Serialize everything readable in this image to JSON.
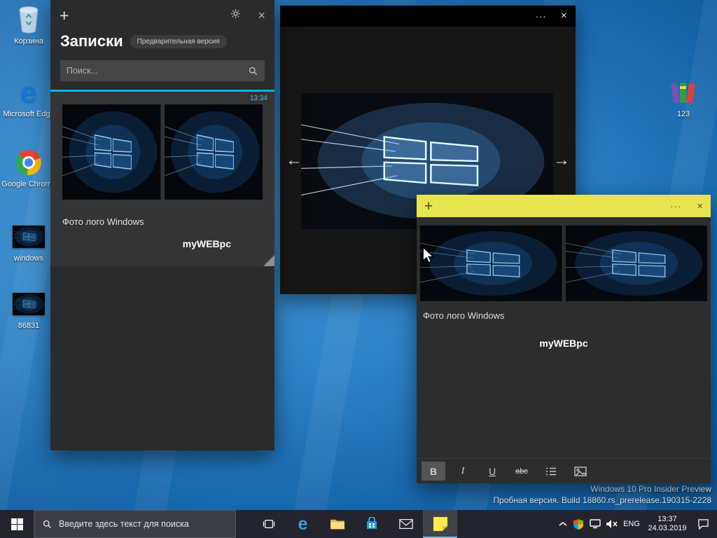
{
  "glyphs": {
    "plus": "+",
    "close": "×",
    "more": "···",
    "back": "←",
    "forward": "→",
    "edge": "e"
  },
  "desktop": {
    "icons_left": [
      {
        "label": "Корзина"
      },
      {
        "label": "Microsoft Edge"
      },
      {
        "label": "Google Chrome"
      },
      {
        "label": "windows"
      },
      {
        "label": "86831"
      }
    ],
    "icon_right": {
      "label": "123"
    },
    "watermark": {
      "line1": "Windows 10 Pro Insider Preview",
      "line2": "Пробная версия. Build 18860.rs_prerelease.190315-2228"
    }
  },
  "notes_list": {
    "title": "Записки",
    "badge": "Предварительная версия",
    "search_placeholder": "Поиск...",
    "note": {
      "time": "13:34",
      "caption": "Фото лого Windows",
      "footer": "myWEBpc"
    }
  },
  "note_window": {
    "caption": "Фото лого Windows",
    "footer": "myWEBpc",
    "toolbar": {
      "bold": "B",
      "italic": "I",
      "underline": "U",
      "strike": "abc"
    }
  },
  "taskbar": {
    "search_placeholder": "Введите здесь текст для поиска",
    "tray": {
      "lang": "ENG",
      "time": "13:37",
      "date": "24.03.2019"
    }
  },
  "colors": {
    "accent_cyan": "#00b0f0",
    "note_yellow": "#e8e44f",
    "taskbar": "#24242e",
    "desktop_blue": "#2b82c8"
  }
}
